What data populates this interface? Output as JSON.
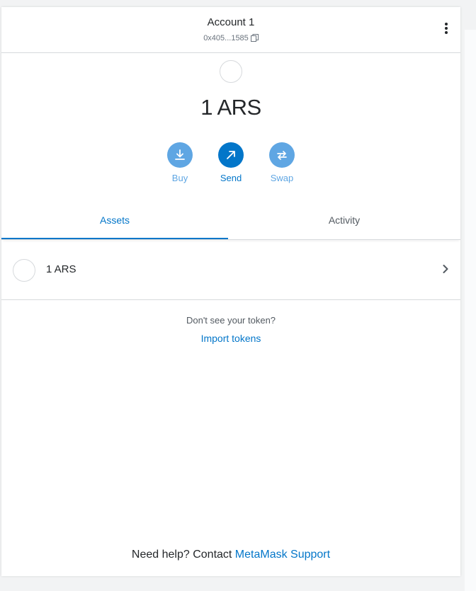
{
  "header": {
    "account_name": "Account 1",
    "address": "0x405...1585",
    "copy_icon": "copy-icon",
    "menu_icon": "kebab-menu-icon"
  },
  "balance": {
    "amount": "1 ARS"
  },
  "actions": {
    "buy": {
      "label": "Buy",
      "icon": "download-icon",
      "color": "#5fa6e3"
    },
    "send": {
      "label": "Send",
      "icon": "arrow-up-right-icon",
      "color": "#0376c9"
    },
    "swap": {
      "label": "Swap",
      "icon": "swap-arrows-icon",
      "color": "#5fa6e3"
    }
  },
  "tabs": [
    {
      "label": "Assets",
      "active": true
    },
    {
      "label": "Activity",
      "active": false
    }
  ],
  "assets": [
    {
      "label": "1 ARS"
    }
  ],
  "import": {
    "prompt": "Don't see your token?",
    "link": "Import tokens"
  },
  "help": {
    "prefix": "Need help? Contact ",
    "link": "MetaMask Support"
  },
  "colors": {
    "accent": "#0376c9",
    "accent_light": "#5fa6e3",
    "text": "#24272a",
    "muted": "#6a737d",
    "border": "#d6d9dc"
  }
}
